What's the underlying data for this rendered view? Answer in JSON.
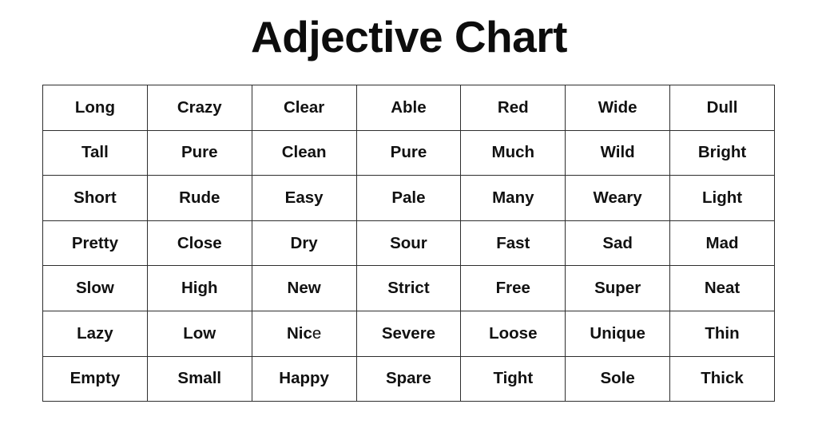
{
  "title": "Adjective Chart",
  "colors": {
    "page_background": "#ffffff",
    "cell_background": "#ffffff",
    "border": "#2e2e2e",
    "text": "#111111",
    "title_text": "#0d0d0d"
  },
  "chart_data": {
    "type": "table",
    "title": "Adjective Chart",
    "columns": 7,
    "rows_count": 7,
    "has_header_row": false,
    "rows": [
      [
        "Long",
        "Crazy",
        "Clear",
        "Able",
        "Red",
        "Wide",
        "Dull"
      ],
      [
        "Tall",
        "Pure",
        "Clean",
        "Pure",
        "Much",
        "Wild",
        "Bright"
      ],
      [
        "Short",
        "Rude",
        "Easy",
        "Pale",
        "Many",
        "Weary",
        "Light"
      ],
      [
        "Pretty",
        "Close",
        "Dry",
        "Sour",
        "Fast",
        "Sad",
        "Mad"
      ],
      [
        "Slow",
        "High",
        "New",
        "Strict",
        "Free",
        "Super",
        "Neat"
      ],
      [
        "Lazy",
        "Low",
        "Nice",
        "Severe",
        "Loose",
        "Unique",
        "Thin"
      ],
      [
        "Empty",
        "Small",
        "Happy",
        "Spare",
        "Tight",
        "Sole",
        "Thick"
      ]
    ],
    "notes": "Cell at row 6, column 3 ('Nice') renders its final letter 'e' in a lighter weight than the rest of the word."
  }
}
